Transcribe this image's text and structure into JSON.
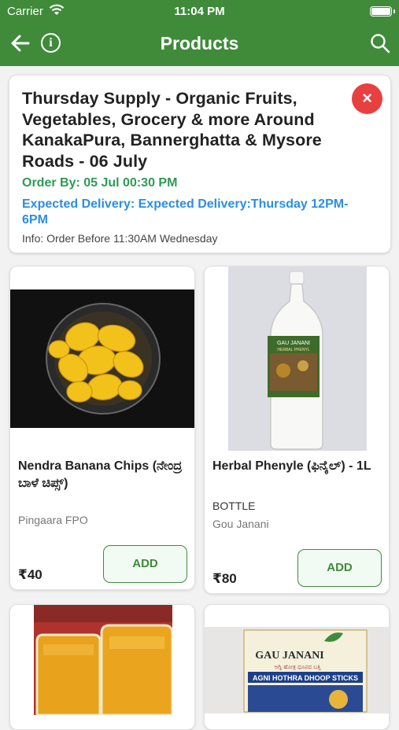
{
  "status_bar": {
    "carrier": "Carrier",
    "time": "11:04 PM"
  },
  "nav": {
    "title": "Products",
    "icons": [
      "back-arrow-icon",
      "info-icon",
      "search-icon"
    ]
  },
  "supply": {
    "title": "Thursday Supply - Organic Fruits, Vegetables, Grocery & more Around KanakaPura, Bannerghatta & Mysore Roads - 06 July",
    "order_by": "Order By: 05 Jul 00:30 PM",
    "delivery": "Expected Delivery: Expected Delivery:Thursday 12PM-6PM",
    "info": "Info: Order Before 11:30AM Wednesday",
    "close_label": "×"
  },
  "products": [
    {
      "name": "Nendra Banana Chips (ನೇಂದ್ರ ಬಾಳೆ ಚಿಪ್ಸ್)",
      "unit": "",
      "vendor": "Pingaara FPO",
      "price": "₹40",
      "add_label": "ADD"
    },
    {
      "name": "Herbal Phenyle (ಫಿನೈಲ್) - 1L",
      "unit": "BOTTLE",
      "vendor": "Gou Janani",
      "price": "₹80",
      "add_label": "ADD"
    },
    {
      "name": "",
      "unit": "",
      "vendor": "",
      "price": "",
      "add_label": ""
    },
    {
      "name": "",
      "unit": "",
      "vendor": "",
      "price": "",
      "add_label": ""
    }
  ],
  "images": {
    "phenyle_label": "GAU JANANI",
    "phenyle_sub": "HERBAL PHENYL",
    "dhoop_brand": "GAU JANANI",
    "dhoop_title": "AGNI HOTHRA DHOOP STICKS",
    "dhoop_kannada": "ಅಗ್ನಿ ಹೋತ್ರ ಧೂಪದ ಬತ್ತಿ"
  },
  "colors": {
    "header": "#3f8b3a",
    "order_by": "#2e9a55",
    "delivery": "#2b8ee0",
    "close": "#e84040"
  }
}
